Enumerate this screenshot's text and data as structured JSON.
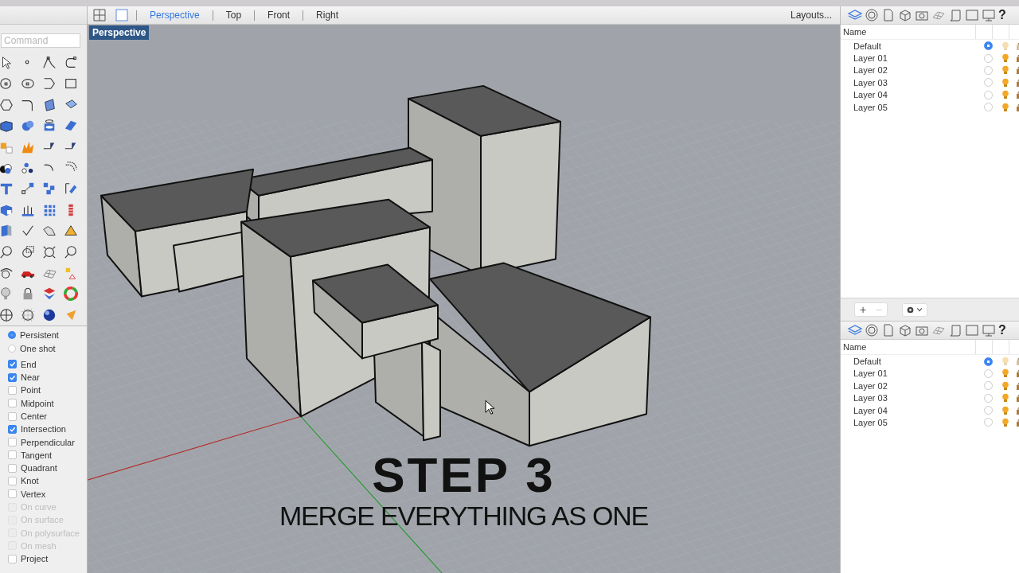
{
  "view_toolbar": {
    "views": [
      {
        "label": "Perspective",
        "selected": true
      },
      {
        "label": "Top",
        "selected": false
      },
      {
        "label": "Front",
        "selected": false
      },
      {
        "label": "Right",
        "selected": false
      }
    ],
    "layouts": "Layouts..."
  },
  "command": {
    "placeholder": "Command"
  },
  "viewport": {
    "label": "Perspective",
    "caption_title": "STEP 3",
    "caption_subtitle": "MERGE EVERYTHING AS ONE"
  },
  "osnap_modes": [
    {
      "label": "Persistent",
      "selected": true
    },
    {
      "label": "One shot",
      "selected": false
    }
  ],
  "osnaps": [
    {
      "label": "End",
      "checked": true,
      "disabled": false
    },
    {
      "label": "Near",
      "checked": true,
      "disabled": false
    },
    {
      "label": "Point",
      "checked": false,
      "disabled": false
    },
    {
      "label": "Midpoint",
      "checked": false,
      "disabled": false
    },
    {
      "label": "Center",
      "checked": false,
      "disabled": false
    },
    {
      "label": "Intersection",
      "checked": true,
      "disabled": false
    },
    {
      "label": "Perpendicular",
      "checked": false,
      "disabled": false
    },
    {
      "label": "Tangent",
      "checked": false,
      "disabled": false
    },
    {
      "label": "Quadrant",
      "checked": false,
      "disabled": false
    },
    {
      "label": "Knot",
      "checked": false,
      "disabled": false
    },
    {
      "label": "Vertex",
      "checked": false,
      "disabled": false
    },
    {
      "label": "On curve",
      "checked": false,
      "disabled": true
    },
    {
      "label": "On surface",
      "checked": false,
      "disabled": true
    },
    {
      "label": "On polysurface",
      "checked": false,
      "disabled": true
    },
    {
      "label": "On mesh",
      "checked": false,
      "disabled": true
    },
    {
      "label": "Project",
      "checked": false,
      "disabled": false
    }
  ],
  "layer_panels": [
    {
      "help": "?",
      "column": "Name",
      "layers": [
        {
          "name": "Default",
          "current": true,
          "light_dimmed": true
        },
        {
          "name": "Layer 01",
          "current": false,
          "light_dimmed": false
        },
        {
          "name": "Layer 02",
          "current": false,
          "light_dimmed": false
        },
        {
          "name": "Layer 03",
          "current": false,
          "light_dimmed": false
        },
        {
          "name": "Layer 04",
          "current": false,
          "light_dimmed": false
        },
        {
          "name": "Layer 05",
          "current": false,
          "light_dimmed": false
        }
      ],
      "footer": {
        "add": "+",
        "remove": "−",
        "remove_disabled": true
      }
    },
    {
      "help": "?",
      "column": "Name",
      "layers": [
        {
          "name": "Default",
          "current": true,
          "light_dimmed": true
        },
        {
          "name": "Layer 01",
          "current": false,
          "light_dimmed": false
        },
        {
          "name": "Layer 02",
          "current": false,
          "light_dimmed": false
        },
        {
          "name": "Layer 03",
          "current": false,
          "light_dimmed": false
        },
        {
          "name": "Layer 04",
          "current": false,
          "light_dimmed": false
        },
        {
          "name": "Layer 05",
          "current": false,
          "light_dimmed": false
        }
      ]
    }
  ]
}
